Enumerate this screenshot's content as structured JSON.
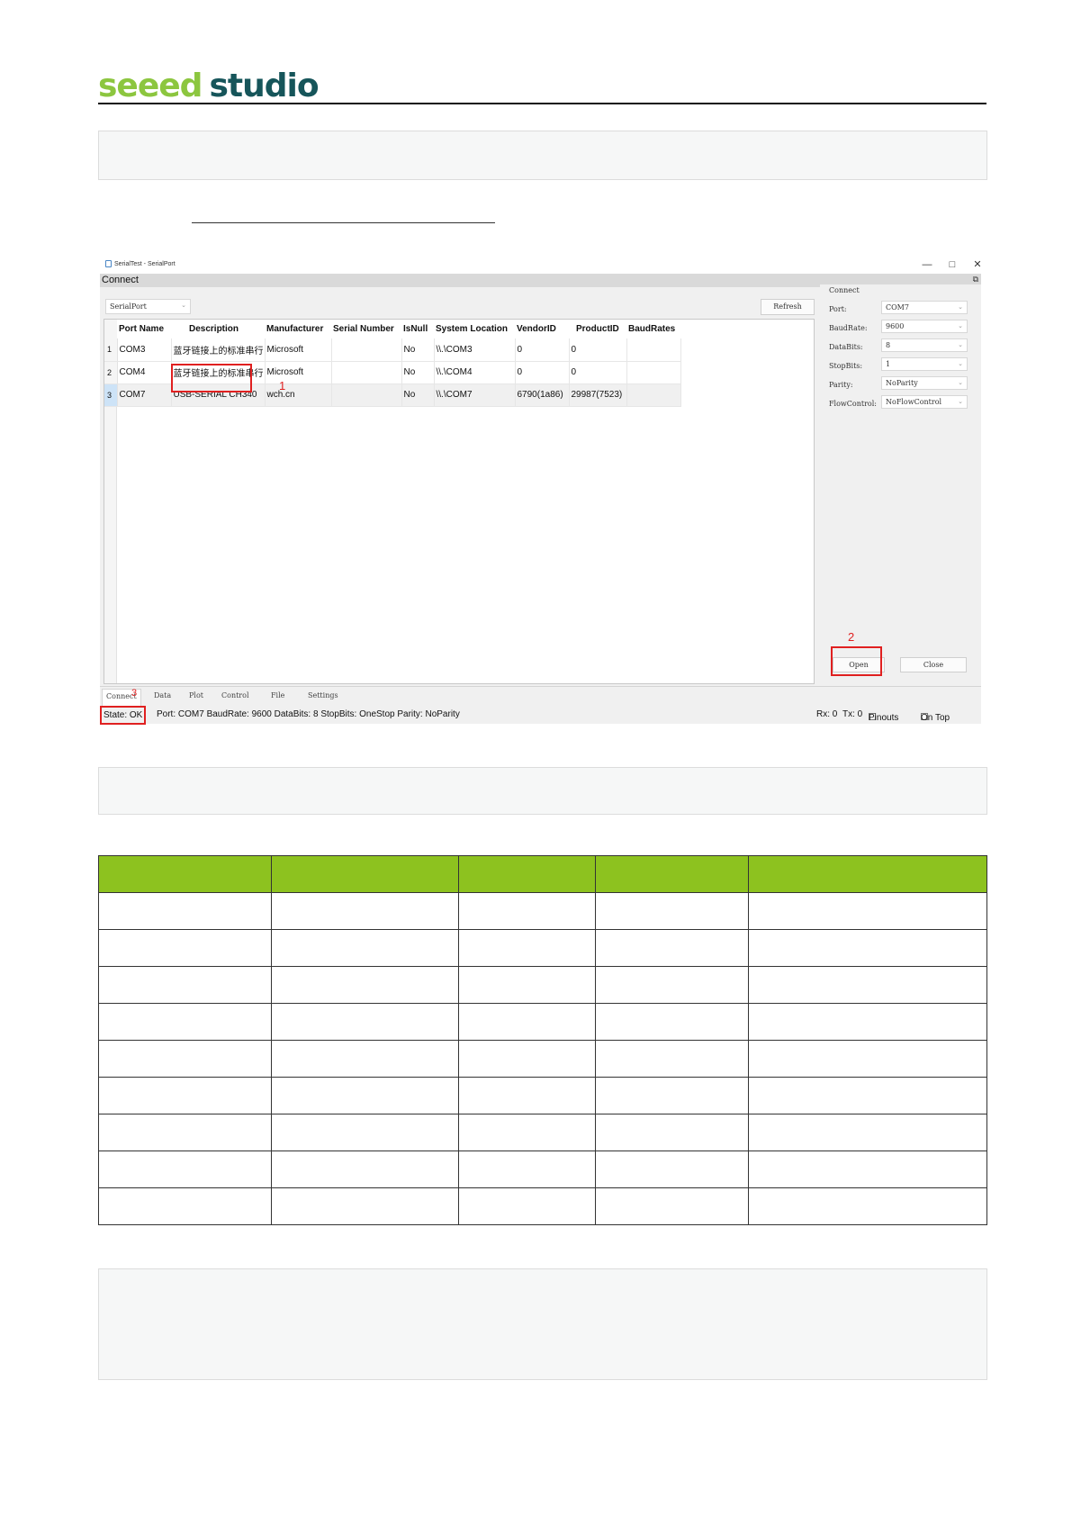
{
  "header": {
    "logo_part1": "seeed",
    "logo_part2": "studio"
  },
  "app": {
    "window_title": "SerialTest - SerialPort",
    "window_controls": {
      "minimize": "—",
      "maximize": "□",
      "close": "✕"
    },
    "connect_label": "Connect",
    "serial_type_select": "SerialPort",
    "refresh_button": "Refresh",
    "ports_table": {
      "columns": [
        "Port Name",
        "Description",
        "Manufacturer",
        "Serial Number",
        "IsNull",
        "System Location",
        "VendorID",
        "ProductID",
        "BaudRates"
      ],
      "rows": [
        {
          "num": "1",
          "cells": [
            "COM3",
            "蓝牙链接上的标准串行",
            "Microsoft",
            "",
            "No",
            "\\\\.\\COM3",
            "0",
            "0",
            ""
          ]
        },
        {
          "num": "2",
          "cells": [
            "COM4",
            "蓝牙链接上的标准串行",
            "Microsoft",
            "",
            "No",
            "\\\\.\\COM4",
            "0",
            "0",
            ""
          ]
        },
        {
          "num": "3",
          "cells": [
            "COM7",
            "USB-SERIAL CH340",
            "wch.cn",
            "",
            "No",
            "\\\\.\\COM7",
            "6790(1a86)",
            "29987(7523)",
            ""
          ]
        }
      ]
    },
    "settings_panel": {
      "title": "Connect",
      "port_label": "Port:",
      "port_value": "COM7",
      "baud_label": "BaudRate:",
      "baud_value": "9600",
      "databits_label": "DataBits:",
      "databits_value": "8",
      "stopbits_label": "StopBits:",
      "stopbits_value": "1",
      "parity_label": "Parity:",
      "parity_value": "NoParity",
      "flow_label": "FlowControl:",
      "flow_value": "NoFlowControl"
    },
    "open_button": "Open",
    "close_button": "Close",
    "tabs": [
      "Connect",
      "Data",
      "Plot",
      "Control",
      "File",
      "Settings"
    ],
    "status": {
      "state": "State: OK",
      "port_info": "Port: COM7 BaudRate: 9600 DataBits: 8 StopBits: OneStop Parity: NoParity",
      "rx": "Rx: 0",
      "tx": "Tx: 0",
      "pinouts_label": "Pinouts",
      "ontop_label": "On Top"
    },
    "annotations": {
      "a1": "1",
      "a2": "2",
      "a3": "3"
    }
  },
  "colors": {
    "brand_green": "#8dc21f",
    "brand_teal": "#16555a",
    "annotation_red": "#e02020"
  }
}
